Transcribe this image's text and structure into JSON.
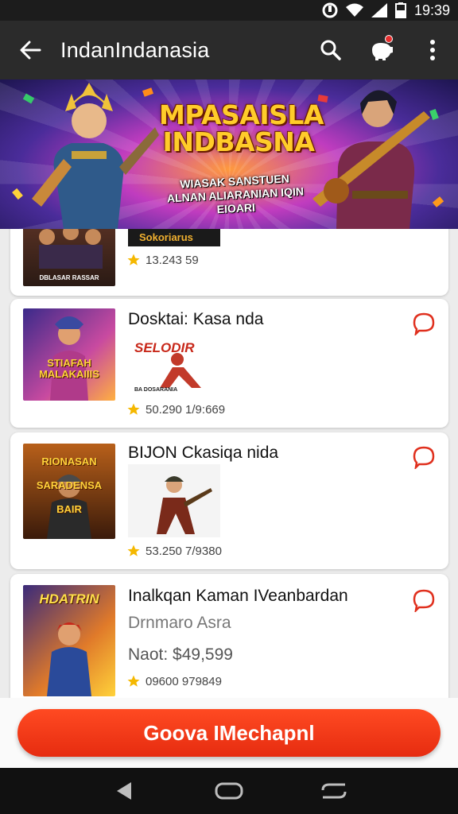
{
  "status_bar": {
    "time": "19:39"
  },
  "app_bar": {
    "title": "IndanIndanasia"
  },
  "banner": {
    "headline": "MPASAISLA INDBASNA",
    "tagline": "WIASAK SANSTUEN ALNAN ALIARANIAN IQIN EIOARI"
  },
  "products": [
    {
      "thumb_caption": "DBLASAR RASSAR",
      "preview_caption": "Sokoriarus",
      "rating": "13.243 59"
    },
    {
      "title": "Dosktai: Kasa nda",
      "thumb_caption": "STIAFAH MALAKAIIIS",
      "preview_caption": "SELODIR",
      "preview_footer": "BA DOSARANIA",
      "rating": "50.290 1/9:669"
    },
    {
      "title": "BIJON Ckasiqa nida",
      "thumb_caption": "RIONASAN SARADENSA BAIR",
      "rating": "53.250 7/9380"
    },
    {
      "title": "Inalkqan Kaman IVeanbardan",
      "subtitle": "Drnmaro Asra",
      "price": "Naot: $49,599",
      "thumb_caption": "HDATRIN",
      "rating": "09600 979849"
    }
  ],
  "cta": {
    "label": "Goova IMechapnl"
  },
  "colors": {
    "accent": "#e62c10",
    "app_bar": "#2b2b2b",
    "star": "#f5b800"
  },
  "icons": [
    "back-arrow-icon",
    "search-icon",
    "piggy-bank-icon",
    "more-vert-icon",
    "chat-bubble-icon",
    "star-icon",
    "nav-back-icon",
    "nav-home-icon",
    "nav-recents-icon"
  ]
}
